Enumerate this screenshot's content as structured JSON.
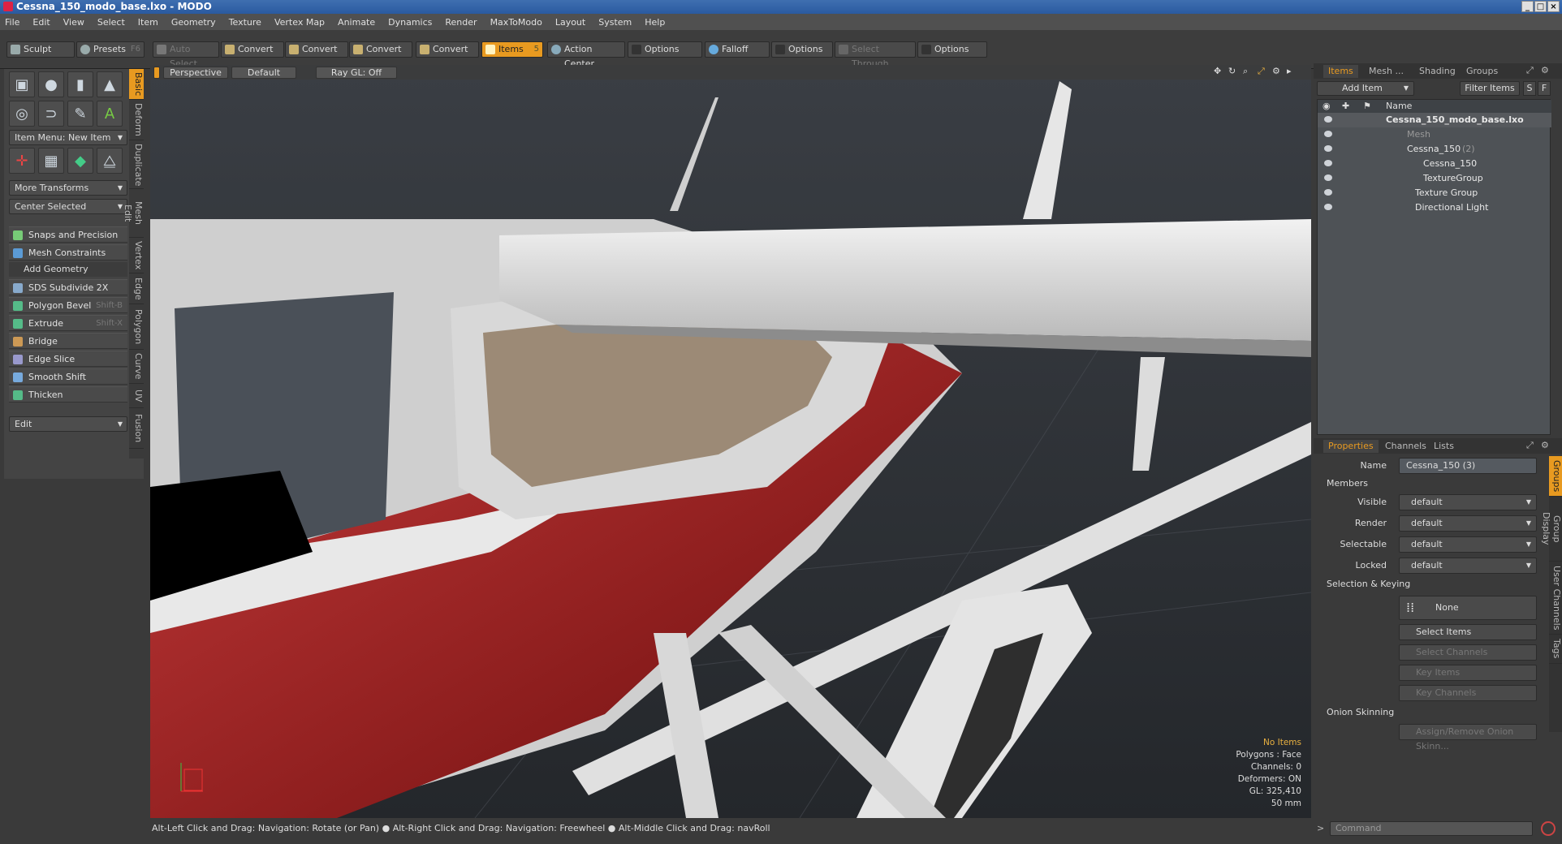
{
  "window": {
    "title": "Cessna_150_modo_base.lxo - MODO"
  },
  "menu": [
    "File",
    "Edit",
    "View",
    "Select",
    "Item",
    "Geometry",
    "Texture",
    "Vertex Map",
    "Animate",
    "Dynamics",
    "Render",
    "MaxToModo",
    "Layout",
    "System",
    "Help"
  ],
  "toolbar": {
    "sculpt": "Sculpt",
    "presets": "Presets",
    "presets_sc": "F6",
    "auto_select": "Auto Select",
    "convert": "Convert",
    "items": "Items",
    "items_sc": "5",
    "action_center": "Action Center",
    "options": "Options",
    "falloff": "Falloff",
    "select_through": "Select Through"
  },
  "left": {
    "item_menu": "Item Menu: New Item",
    "more_transforms": "More Transforms",
    "center_selected": "Center Selected",
    "snaps": "Snaps and Precision",
    "mesh_constraints": "Mesh Constraints",
    "add_geometry": "Add Geometry",
    "tools": [
      {
        "label": "SDS Subdivide 2X",
        "sc": ""
      },
      {
        "label": "Polygon Bevel",
        "sc": "Shift-B"
      },
      {
        "label": "Extrude",
        "sc": "Shift-X"
      },
      {
        "label": "Bridge",
        "sc": ""
      },
      {
        "label": "Edge Slice",
        "sc": ""
      },
      {
        "label": "Smooth Shift",
        "sc": ""
      },
      {
        "label": "Thicken",
        "sc": ""
      }
    ],
    "edit": "Edit"
  },
  "vtabs": [
    "Basic",
    "Deform",
    "Duplicate",
    "Mesh Edit",
    "Vertex",
    "Edge",
    "Polygon",
    "Curve",
    "UV",
    "Fusion"
  ],
  "viewport": {
    "perspective": "Perspective",
    "default": "Default",
    "raygl": "Ray GL: Off",
    "info": {
      "no_items": "No Items",
      "polygons": "Polygons : Face",
      "channels": "Channels: 0",
      "deformers": "Deformers: ON",
      "gl": "GL: 325,410",
      "mm": "50 mm"
    }
  },
  "status": "Alt-Left Click and Drag: Navigation: Rotate (or Pan) ●  Alt-Right Click and Drag: Navigation: Freewheel ●  Alt-Middle Click and Drag: navRoll",
  "right": {
    "tabs": [
      "Items",
      "Mesh ...",
      "Shading",
      "Groups"
    ],
    "add_item": "Add Item",
    "filter_items": "Filter Items",
    "filter_s": "S",
    "filter_f": "F",
    "col_name": "Name",
    "tree": [
      {
        "label": "Cessna_150_modo_base.lxo",
        "suffix": "",
        "bold": true,
        "dim": false
      },
      {
        "label": "Mesh",
        "suffix": "",
        "bold": false,
        "dim": true
      },
      {
        "label": "Cessna_150",
        "suffix": " (2)",
        "bold": false,
        "dim": false
      },
      {
        "label": "Cessna_150",
        "suffix": "",
        "bold": false,
        "dim": false
      },
      {
        "label": "TextureGroup",
        "suffix": "",
        "bold": false,
        "dim": false
      },
      {
        "label": "Texture Group",
        "suffix": "",
        "bold": false,
        "dim": false
      },
      {
        "label": "Directional Light",
        "suffix": "",
        "bold": false,
        "dim": false
      }
    ],
    "prop_tabs": [
      "Properties",
      "Channels",
      "Lists"
    ],
    "name_label": "Name",
    "name_value": "Cessna_150 (3)",
    "members": "Members",
    "visible": "Visible",
    "render": "Render",
    "selectable": "Selectable",
    "locked": "Locked",
    "default_val": "default",
    "sel_keying": "Selection & Keying",
    "none": "None",
    "select_items": "Select Items",
    "select_channels": "Select Channels",
    "key_items": "Key Items",
    "key_channels": "Key Channels",
    "onion": "Onion Skinning",
    "assign_onion": "Assign/Remove Onion Skinn...",
    "side_tabs": [
      "Groups",
      "Group Display",
      "User Channels",
      "Tags"
    ],
    "command": "Command"
  }
}
